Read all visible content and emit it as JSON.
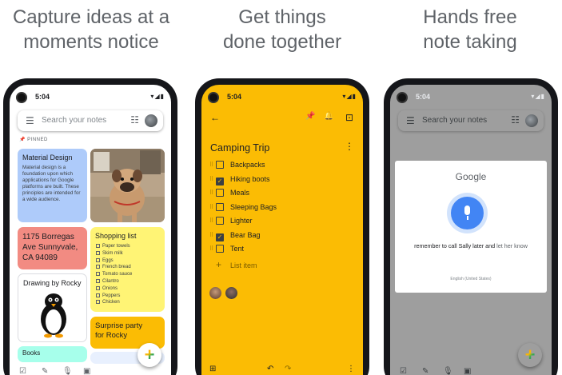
{
  "headlines": [
    {
      "line1": "Capture ideas at a",
      "line2": "moments notice"
    },
    {
      "line1": "Get things",
      "line2": "done together"
    },
    {
      "line1": "Hands free",
      "line2": "note taking"
    }
  ],
  "status": {
    "time": "5:04",
    "icons": "▾◢▮"
  },
  "phone1": {
    "search_placeholder": "Search your notes",
    "menu_icon": "☰",
    "layout_icon": "☷",
    "pinned_label": "PINNED",
    "notes": {
      "material": {
        "title": "Material Design",
        "body": "Material design is a foundation upon which applications for Google platforms are built. These principles are intended for a wide audience."
      },
      "address": {
        "line1": "1175 Borregas",
        "line2": "Ave Sunnyvale,",
        "line3": "CA 94089"
      },
      "shopping": {
        "title": "Shopping list",
        "items": [
          "Paper towels",
          "Skim milk",
          "Eggs",
          "French bread",
          "Tomato sauce",
          "Cilantro",
          "Onions",
          "Peppers",
          "Chicken"
        ]
      },
      "drawing": {
        "title": "Drawing by Rocky"
      },
      "surprise": {
        "line1": "Surprise party",
        "line2": "for Rocky"
      },
      "teal": {
        "title": "Books"
      }
    },
    "bottom_icons": {
      "check": "☑",
      "brush": "✎",
      "mic": "🎙",
      "image": "▣"
    }
  },
  "phone2": {
    "toolbar": {
      "back": "←",
      "pin": "📌",
      "reminder": "🔔",
      "archive": "⊡"
    },
    "title": "Camping Trip",
    "more": "⋮",
    "items": [
      {
        "label": "Backpacks",
        "checked": false
      },
      {
        "label": "Hiking boots",
        "checked": true
      },
      {
        "label": "Meals",
        "checked": false
      },
      {
        "label": "Sleeping Bags",
        "checked": false
      },
      {
        "label": "Lighter",
        "checked": false
      },
      {
        "label": "Bear Bag",
        "checked": true
      },
      {
        "label": "Tent",
        "checked": false
      }
    ],
    "add_item": "List item",
    "bottom": {
      "add": "⊞",
      "undo": "↶",
      "redo": "↷",
      "more": "⋮"
    }
  },
  "phone3": {
    "search_placeholder": "Search your notes",
    "dialog": {
      "logo": "Google",
      "speech_main": "remember to call Sally later and ",
      "speech_pending": "let her know",
      "language": "English (United States)"
    }
  },
  "colors": {
    "yellow": "#fbbc04",
    "blue": "#aecbfa",
    "red": "#f28b82",
    "lightyellow": "#fff475",
    "teal": "#a7ffeb",
    "mic_blue": "#4285f4"
  }
}
